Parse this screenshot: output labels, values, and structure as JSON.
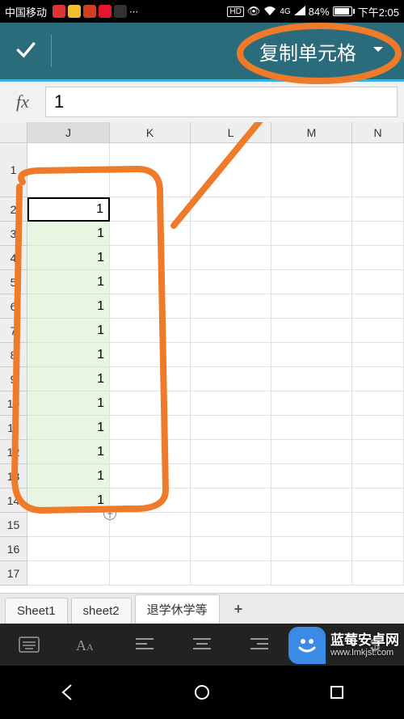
{
  "status_bar": {
    "carrier": "中国移动",
    "hd": "HD",
    "network": "4G",
    "battery_pct": "84%",
    "time": "下午2:05"
  },
  "action_bar": {
    "right_label": "复制单元格"
  },
  "formula_bar": {
    "fx": "fx",
    "value": "1"
  },
  "columns": [
    "J",
    "K",
    "L",
    "M",
    "N"
  ],
  "rows": [
    1,
    2,
    3,
    4,
    5,
    6,
    7,
    8,
    9,
    10,
    11,
    12,
    13,
    14,
    15,
    16,
    17
  ],
  "cell_values": {
    "J2": "1",
    "J3": "1",
    "J4": "1",
    "J5": "1",
    "J6": "1",
    "J7": "1",
    "J8": "1",
    "J9": "1",
    "J10": "1",
    "J11": "1",
    "J12": "1",
    "J13": "1",
    "J14": "1"
  },
  "sheets": {
    "tabs": [
      "Sheet1",
      "sheet2",
      "退学休学等"
    ],
    "active_index": 2,
    "add": "+"
  },
  "watermark": {
    "title": "蓝莓安卓网",
    "url": "www.lmkjst.com"
  }
}
